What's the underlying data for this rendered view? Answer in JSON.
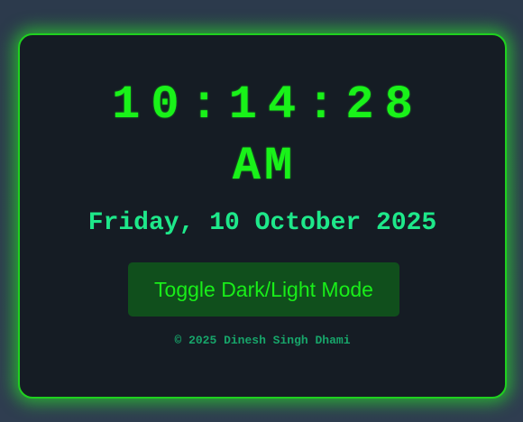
{
  "clock": {
    "time": "10:14:28",
    "period": "AM",
    "date": "Friday, 10 October 2025"
  },
  "toggle": {
    "label": "Toggle Dark/Light Mode"
  },
  "footer": {
    "text": "© 2025 Dinesh Singh Dhami"
  },
  "colors": {
    "background": "#2c3a4c",
    "card_background": "#151c24",
    "accent_green": "#19f219",
    "date_green": "#1ee88a",
    "button_background": "#104f1c",
    "footer_text": "#17a56a"
  }
}
